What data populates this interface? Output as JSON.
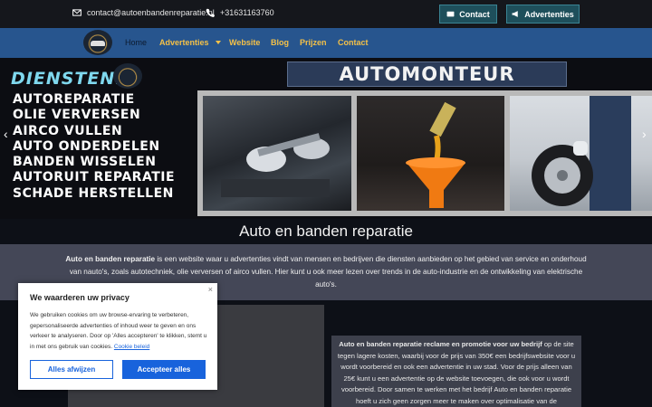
{
  "topbar": {
    "email": "contact@autoenbandenreparatie.nl",
    "phone": "+31631163760",
    "contact_button": "Contact",
    "ads_button": "Advertenties"
  },
  "nav": {
    "items": [
      {
        "label": "Home"
      },
      {
        "label": "Advertenties"
      },
      {
        "label": "Website"
      },
      {
        "label": "Blog"
      },
      {
        "label": "Prijzen"
      },
      {
        "label": "Contact"
      }
    ]
  },
  "hero": {
    "title": "DIENSTEN:",
    "services": [
      "AUTOREPARATIE",
      "OLIE VERVERSEN",
      "AIRCO VULLEN",
      "AUTO ONDERDELEN",
      "BANDEN WISSELEN",
      "AUTORUIT REPARATIE",
      "SCHADE HERSTELLEN"
    ],
    "banner": "AUTOMONTEUR",
    "prev_arrow": "‹",
    "next_arrow": "›"
  },
  "section_title": "Auto en banden reparatie",
  "intro": {
    "bold": "Auto en banden reparatie",
    "text": " is een website waar u advertenties vindt van mensen en bedrijven die diensten aanbieden op het gebied van service en onderhoud van nauto's, zoals autotechniek, olie verversen of airco vullen. Hier kunt u ook meer lezen over trends in de auto-industrie en de ontwikkeling van elektrische auto's."
  },
  "promo": {
    "bold": "Auto en banden reparatie reclame en promotie voor uw bedrijf",
    "text": " op de site tegen lagere kosten, waarbij voor de prijs van 350€ een bedrijfswebsite voor u wordt voorbereid en ook een advertentie in uw stad. Voor de prijs alleen van 25€ kunt u een advertentie op de website toevoegen, die ook voor u wordt voorbereid. Door samen te werken met het bedrijf Auto en banden reparatie hoeft u zich geen zorgen meer te maken over optimalisatie van de"
  },
  "cookie": {
    "close": "×",
    "title": "We waarderen uw privacy",
    "text": "We gebruiken cookies om uw browse-ervaring te verbeteren, gepersonaliseerde advertenties of inhoud weer te geven en ons verkeer te analyseren. Door op 'Alles accepteren' te klikken, stemt u in met ons gebruik van cookies.",
    "link": "Cookie beleid",
    "reject": "Alles afwijzen",
    "accept": "Accepteer alles"
  }
}
